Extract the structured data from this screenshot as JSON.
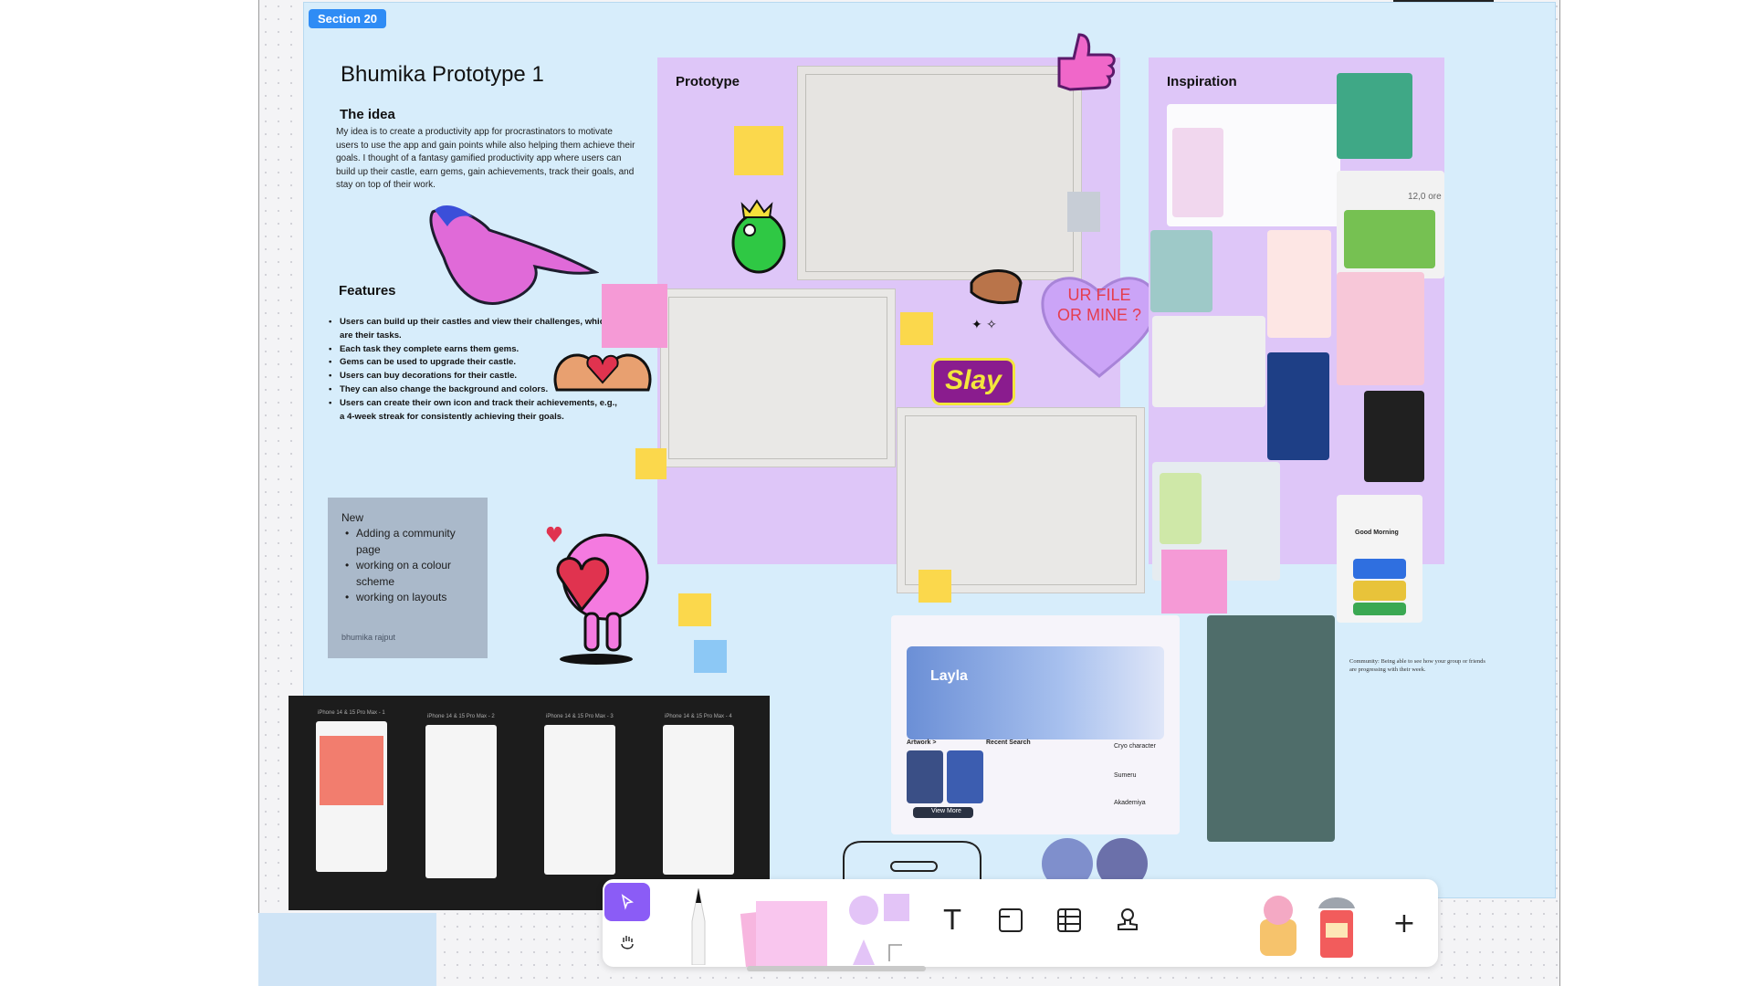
{
  "section": {
    "tag": "Section 20"
  },
  "doc": {
    "title": "Bhumika Prototype 1",
    "idea_heading": "The idea",
    "idea_text": "My idea is to create a productivity app for procrastinators to motivate users to use the app and gain points while also helping them achieve their goals. I thought of a fantasy gamified productivity app where users can build up their castle, earn gems, gain achievements, track their goals, and stay on top of their work.",
    "features_heading": "Features",
    "features": [
      "Users can build up their castles and view their challenges, which are their tasks.",
      "Each task they complete earns them gems.",
      "Gems can be used to upgrade their castle.",
      "Users can buy decorations for their castle.",
      "They can also change the background and colors.",
      "Users can create their own icon and track their achievements, e.g., a 4-week streak for consistently achieving their goals."
    ]
  },
  "new_box": {
    "title": "New",
    "items": [
      "Adding a community page",
      "working on a colour scheme",
      "working on layouts"
    ],
    "author": "bhumika rajput"
  },
  "panels": {
    "prototype_label": "Prototype",
    "inspiration_label": "Inspiration"
  },
  "stickers": {
    "heart_text": "UR FILE OR MINE ?",
    "slay": "Slay"
  },
  "game_ui": {
    "hero_title": "Layla",
    "artwork": "Artwork >",
    "recent_search": "Recent Search",
    "view_more": "View More",
    "results": [
      "Cryo character",
      "Sumeru",
      "Akademiya"
    ]
  },
  "community_note": "Community: Being able to see how your group or friends are progressing with their week.",
  "wireframe_captions": [
    "iPhone 14 & 15 Pro Max - 1",
    "iPhone 14 & 15 Pro Max - 2",
    "iPhone 14 & 15 Pro Max - 3",
    "iPhone 14 & 15 Pro Max - 4"
  ],
  "inspiration_labels": {
    "good_morning": "Good Morning",
    "time": "12,0 ore"
  },
  "colors": {
    "accent": "#8b5cf6",
    "section_bg": "#d7edfb",
    "panel_purple": "#dec6f8",
    "section_tag": "#2f8cf5"
  },
  "toolbar": {
    "tools": [
      "select-tool",
      "hand-tool",
      "pen-tool",
      "sticky-note-tool",
      "shapes-tool",
      "text-tool",
      "frame-tool",
      "table-tool",
      "stamp-tool",
      "stickers-tool",
      "widgets-tool",
      "add-tool"
    ]
  }
}
